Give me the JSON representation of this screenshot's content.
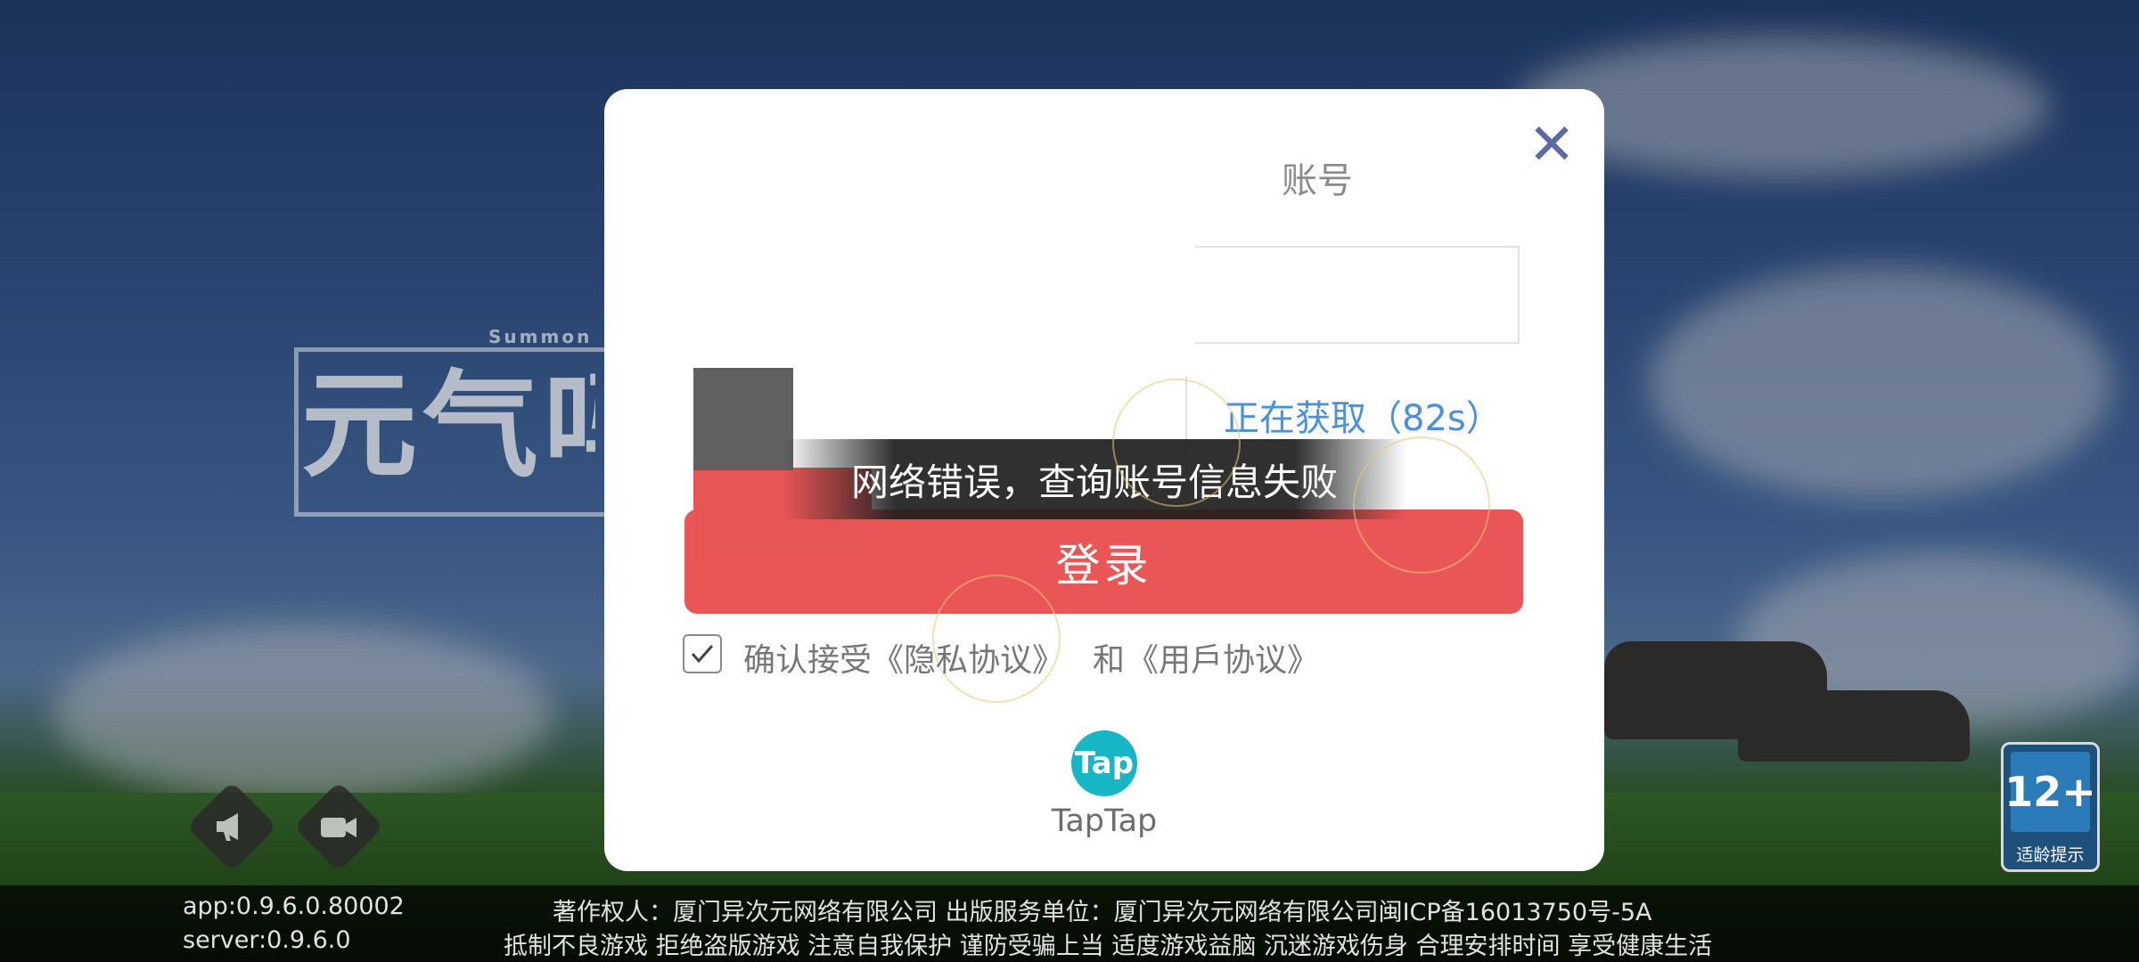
{
  "background": {
    "logo_subtitle": "Summon",
    "logo_title": "元气吗"
  },
  "side_buttons": {
    "announcement_icon": "megaphone-icon",
    "video_icon": "camera-icon"
  },
  "age_badge": {
    "rating": "12+",
    "caption": "适龄提示"
  },
  "footer": {
    "app_version": "app:0.9.6.0.80002",
    "server_version": "server:0.9.6.0",
    "copyright_line": "著作权人：厦门异次元网络有限公司 出版服务单位：厦门异次元网络有限公司闽ICP备16013750号-5A",
    "health_line": "抵制不良游戏 拒绝盗版游戏 注意自我保护 谨防受骗上当 适度游戏益脑 沉迷游戏伤身 合理安排时间 享受健康生活"
  },
  "login_modal": {
    "close_icon": "✕",
    "account_label": "账号",
    "account_value": "",
    "code_value": "",
    "getting_code_text": "正在获取（82s）",
    "error_toast": "网络错误，查询账号信息失败",
    "login_button": "登录",
    "agree_checked": true,
    "agree_prefix": "确认接受",
    "privacy_link": "《隐私协议》",
    "agree_and": "和",
    "user_link": "《用戶协议》",
    "taptap_icon_text": "Tap",
    "taptap_label": "TapTap",
    "accent_color": "#ea5555",
    "link_color": "#4a8fe0"
  }
}
